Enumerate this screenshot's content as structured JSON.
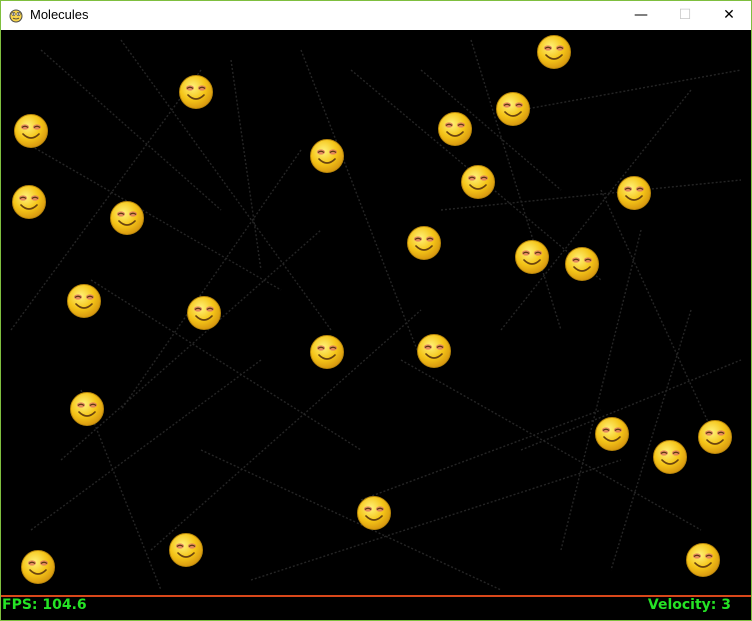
{
  "window": {
    "title": "Molecules",
    "app_icon": "pygame-snake-icon",
    "controls": {
      "minimize": "—",
      "maximize": "☐",
      "close": "✕"
    }
  },
  "hud": {
    "fps_text": "FPS: 104.6",
    "velocity_text": "Velocity: 3",
    "text_color": "#25e325",
    "line_color": "#d9471a"
  },
  "molecules": {
    "icon": "smiley-face-icon",
    "count": 25,
    "colors": {
      "face": "#f5c518",
      "eyes": "#e07a5f",
      "outline": "#b8860b"
    }
  }
}
